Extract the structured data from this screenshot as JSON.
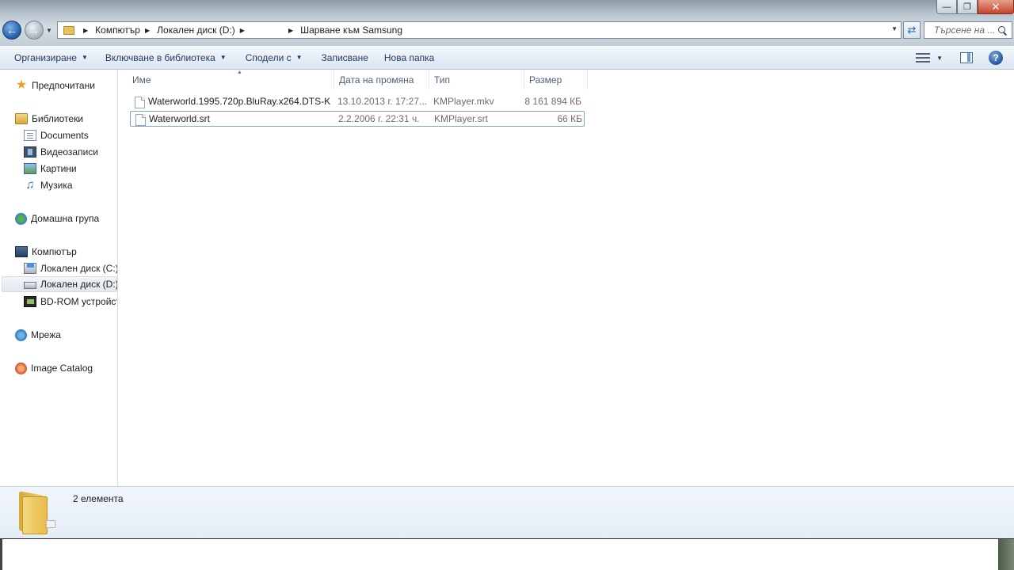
{
  "window": {
    "minimize_label": "—",
    "maximize_label": "❐",
    "close_label": "✕"
  },
  "address": {
    "crumbs": [
      "Компютър",
      "Локален диск (D:)",
      "Шарване към Samsung"
    ],
    "search_placeholder": "Търсене на ..."
  },
  "toolbar": {
    "organize": "Организиране",
    "include_in_library": "Включване в библиотека",
    "share_with": "Сподели с",
    "burn": "Записване",
    "new_folder": "Нова папка",
    "help": "?"
  },
  "nav": {
    "favorites": "Предпочитани",
    "libraries": "Библиотеки",
    "documents": "Documents",
    "videos": "Видеозаписи",
    "pictures": "Картини",
    "music": "Музика",
    "homegroup": "Домашна група",
    "computer": "Компютър",
    "disk_c": "Локален диск (C:)",
    "disk_d": "Локален диск (D:)",
    "bdrom": "BD-ROM устройст",
    "network": "Мрежа",
    "image_catalog": "Image Catalog"
  },
  "columns": {
    "name": "Име",
    "date": "Дата на промяна",
    "type": "Тип",
    "size": "Размер"
  },
  "files": [
    {
      "name": "Waterworld.1995.720p.BluRay.x264.DTS-K...",
      "date": "13.10.2013 г. 17:27...",
      "type": "KMPlayer.mkv",
      "size": "8 161 894 КБ"
    },
    {
      "name": "Waterworld.srt",
      "date": "2.2.2006 г. 22:31 ч.",
      "type": "KMPlayer.srt",
      "size": "66 КБ"
    }
  ],
  "details": {
    "item_count": "2 елемента"
  },
  "colors": {
    "toolbar_text": "#1e395b",
    "header_text": "#4c607a",
    "secondary_text": "#6d6d6d",
    "selection_border": "#7da2ce"
  }
}
